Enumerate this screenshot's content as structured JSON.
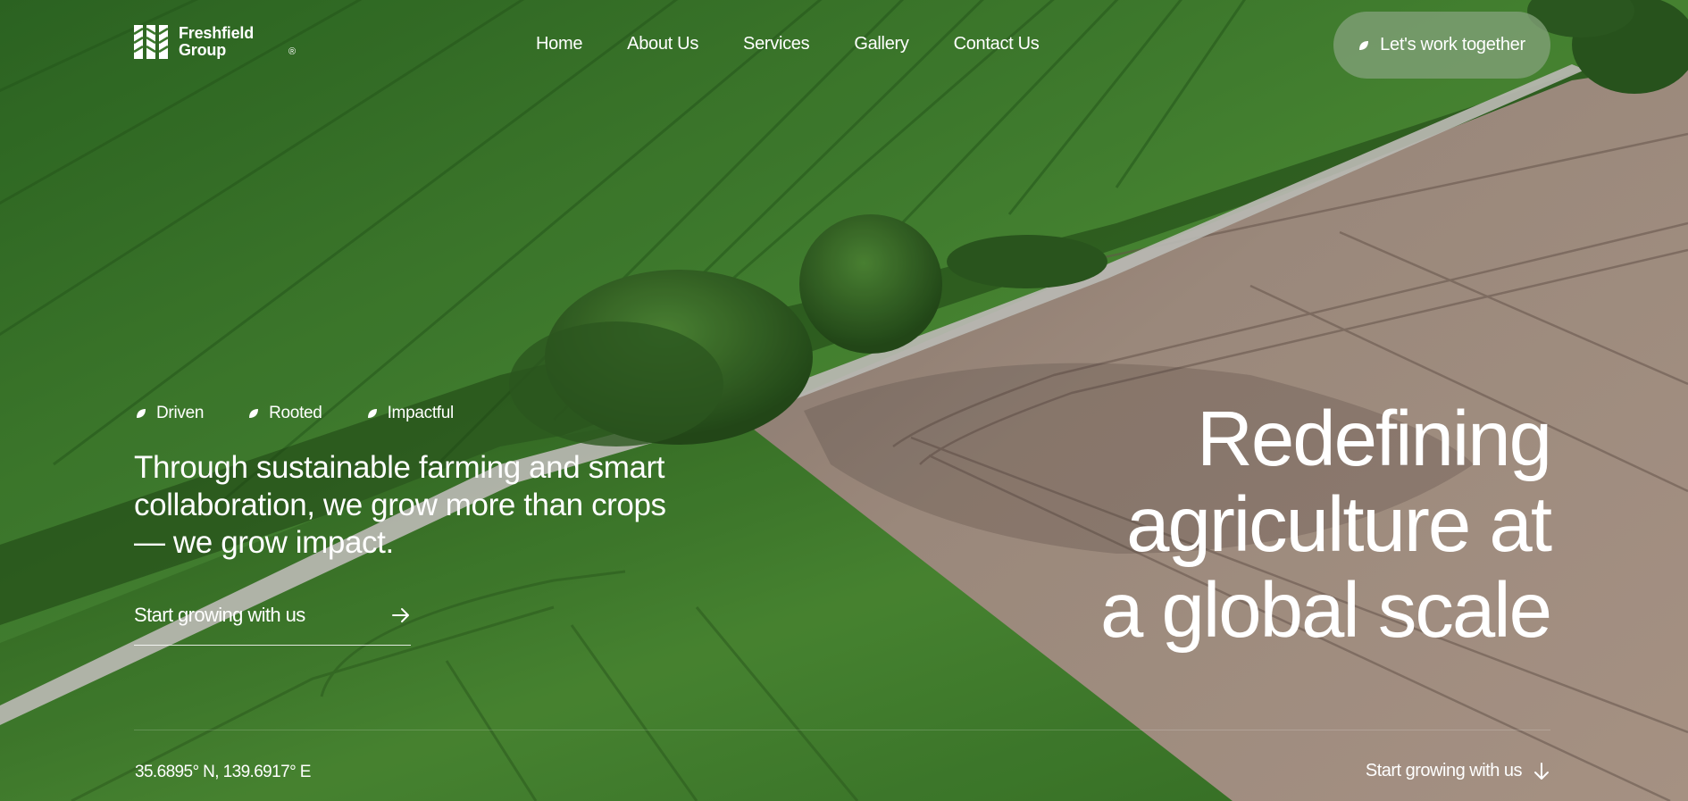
{
  "brand": {
    "name_line1": "Freshfield",
    "name_line2": "Group",
    "registered_mark": "®",
    "logo_icon": "wheat-stripes-logo"
  },
  "nav": {
    "links": [
      "Home",
      "About Us",
      "Services",
      "Gallery",
      "Contact Us"
    ]
  },
  "header_cta": {
    "label": "Let's work together",
    "icon": "leaf-icon"
  },
  "hero": {
    "tags": [
      "Driven",
      "Rooted",
      "Impactful"
    ],
    "tag_icon": "leaf-icon",
    "lede": "Through sustainable farming and smart collaboration, we grow more than crops — we grow impact.",
    "cta_label": "Start growing with us",
    "cta_icon": "arrow-right-icon",
    "headline_line1": "Redefining",
    "headline_line2": "agriculture at",
    "headline_line3": "a global scale"
  },
  "footer_bar": {
    "coordinates": "35.6895° N, 139.6917° E",
    "scroll_label": "Start growing with us",
    "scroll_icon": "arrow-down-icon"
  },
  "colors": {
    "field_green": "#3f7a2c",
    "soil": "#a28e82",
    "text": "#ffffff",
    "pill": "#82a078"
  }
}
